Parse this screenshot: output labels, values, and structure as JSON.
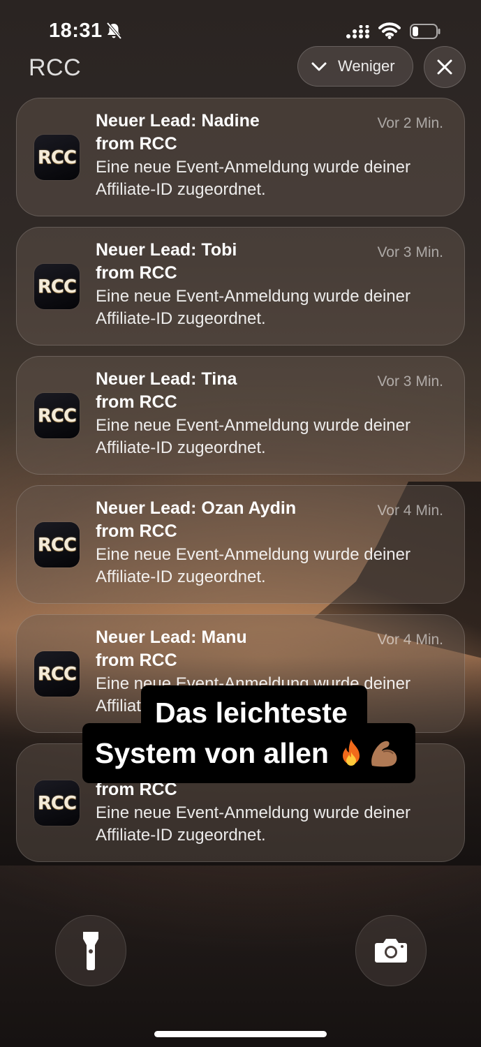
{
  "status_bar": {
    "time": "18:31",
    "icons": [
      "bell-slash-icon",
      "cellular-icon",
      "wifi-icon",
      "battery-icon"
    ],
    "battery_level": 0.25
  },
  "header": {
    "app_name": "RCC",
    "less_button_label": "Weniger",
    "close_icon": "close-icon"
  },
  "notifications": [
    {
      "title": "Neuer Lead: Nadine",
      "from": "from RCC",
      "time": "Vor 2 Min.",
      "body": "Eine neue Event-Anmeldung wurde deiner Affiliate-ID zugeordnet.",
      "app_icon_text": "RCC"
    },
    {
      "title": "Neuer Lead: Tobi",
      "from": "from RCC",
      "time": "Vor 3 Min.",
      "body": "Eine neue Event-Anmeldung wurde deiner Affiliate-ID zugeordnet.",
      "app_icon_text": "RCC"
    },
    {
      "title": "Neuer Lead: Tina",
      "from": "from RCC",
      "time": "Vor 3 Min.",
      "body": "Eine neue Event-Anmeldung wurde deiner Affiliate-ID zugeordnet.",
      "app_icon_text": "RCC"
    },
    {
      "title": "Neuer Lead: Ozan Aydin",
      "from": "from RCC",
      "time": "Vor 4 Min.",
      "body": "Eine neue Event-Anmeldung wurde deiner Affiliate-ID zugeordnet.",
      "app_icon_text": "RCC"
    },
    {
      "title": "Neuer Lead: Manu",
      "from": "from RCC",
      "time": "Vor 4 Min.",
      "body": "Eine neue Event-Anmeldung wurde deiner Affiliate-ID zugeordnet.",
      "app_icon_text": "RCC"
    },
    {
      "title": "",
      "from": "from RCC",
      "time": "",
      "body": "Eine neue Event-Anmeldung wurde deiner Affiliate-ID zugeordnet.",
      "app_icon_text": "RCC"
    }
  ],
  "caption": {
    "line1": "Das leichteste",
    "line2": "System von allen",
    "emojis": [
      "fire-icon",
      "flexed-biceps-icon"
    ]
  },
  "bottom_controls": {
    "left": "flashlight-icon",
    "right": "camera-icon"
  }
}
